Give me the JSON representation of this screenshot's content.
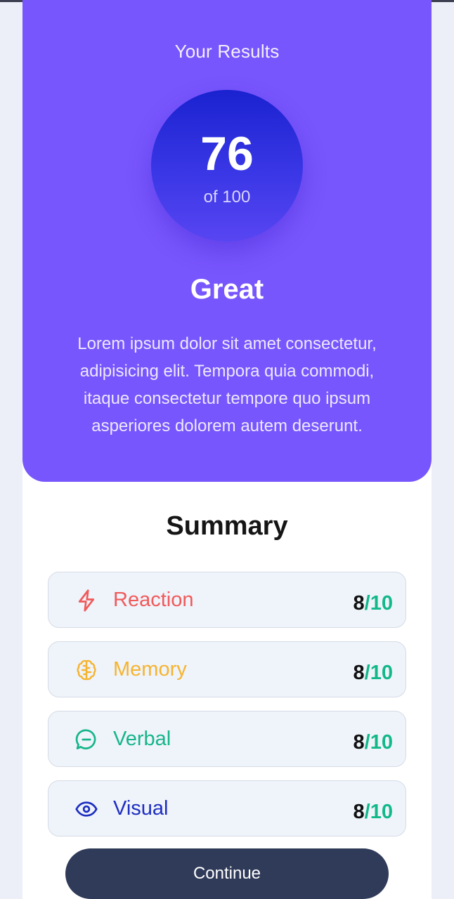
{
  "results": {
    "title": "Your Results",
    "score": "76",
    "score_max": "of 100",
    "grade": "Great",
    "description": "Lorem ipsum dolor sit amet consectetur, adipisicing elit. Tempora quia commodi, itaque consectetur tempore quo ipsum asperiores dolorem autem deserunt."
  },
  "summary": {
    "title": "Summary",
    "items": [
      {
        "label": "Reaction",
        "score": "8",
        "max": "/10",
        "icon": "lightning-icon",
        "color": "#f05a5a"
      },
      {
        "label": "Memory",
        "score": "8",
        "max": "/10",
        "icon": "brain-icon",
        "color": "#f5b430"
      },
      {
        "label": "Verbal",
        "score": "8",
        "max": "/10",
        "icon": "chat-bubble-icon",
        "color": "#16b58a"
      },
      {
        "label": "Visual",
        "score": "8",
        "max": "/10",
        "icon": "eye-icon",
        "color": "#1d2ec0"
      }
    ]
  },
  "continue_label": "Continue",
  "colors": {
    "accent": "#7856fd",
    "button": "#303b59",
    "score_denominator": "#13b88a"
  }
}
